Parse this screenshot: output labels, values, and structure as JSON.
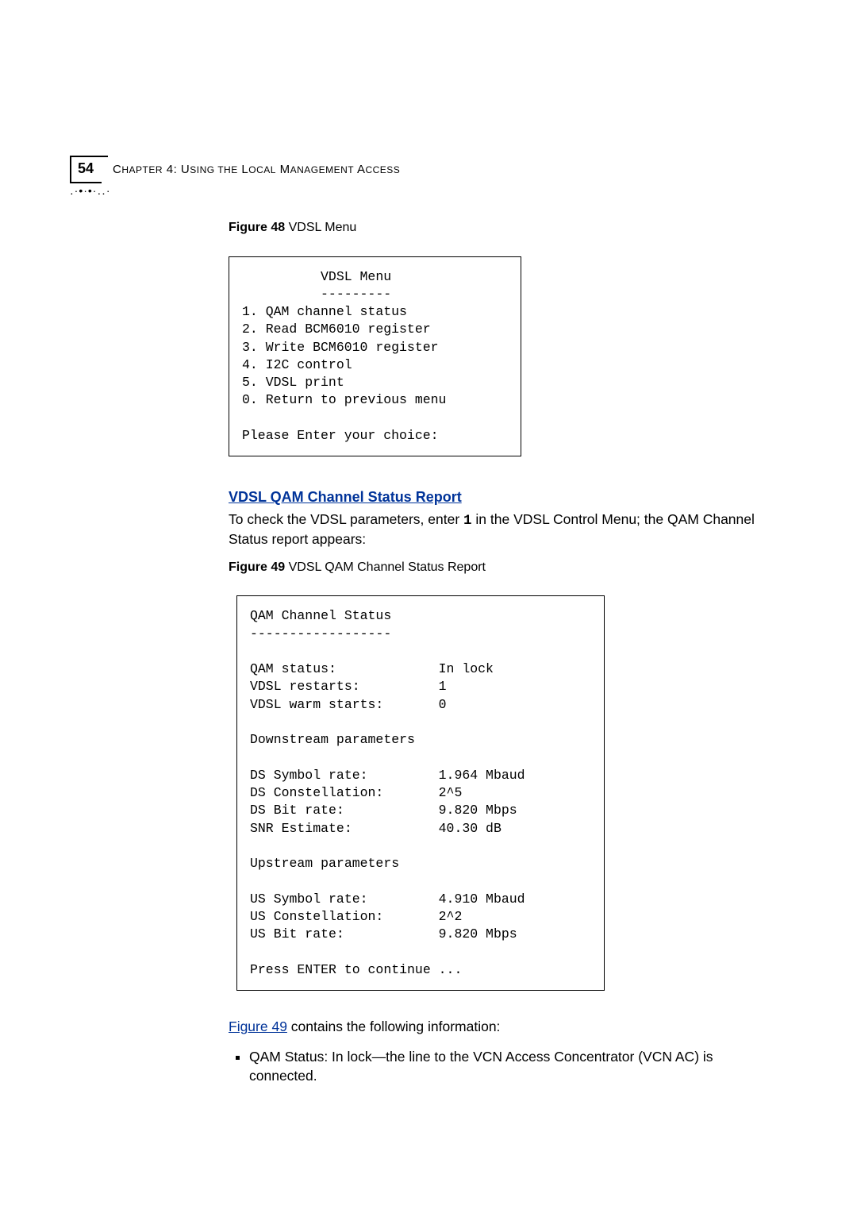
{
  "header": {
    "page_number": "54",
    "chapter_label": "Chapter 4: Using the Local Management Access"
  },
  "figure48": {
    "label_bold": "Figure 48",
    "label_rest": "   VDSL Menu",
    "title_center": "VDSL Menu",
    "title_dash": "---------",
    "items": [
      "1. QAM channel status",
      "2. Read BCM6010 register",
      "3. Write BCM6010 register",
      "4. I2C control",
      "5. VDSL print",
      "0. Return to previous menu"
    ],
    "prompt": "Please Enter your choice:"
  },
  "section": {
    "heading": "VDSL QAM Channel Status Report",
    "intro_before": "To check the VDSL parameters, enter ",
    "intro_key": "1",
    "intro_after": " in the VDSL Control Menu; the QAM Channel Status report appears:"
  },
  "figure49": {
    "label_bold": "Figure 49",
    "label_rest": "   VDSL QAM Channel Status Report",
    "title": "QAM Channel Status",
    "title_dash": "------------------",
    "rows_top": [
      {
        "k": "QAM status:",
        "v": "In lock"
      },
      {
        "k": "VDSL restarts:",
        "v": "1"
      },
      {
        "k": "VDSL warm starts:",
        "v": "0"
      }
    ],
    "ds_hdr": "Downstream parameters",
    "rows_ds": [
      {
        "k": "DS Symbol rate:",
        "v": "1.964 Mbaud"
      },
      {
        "k": "DS Constellation:",
        "v": "2^5"
      },
      {
        "k": "DS Bit rate:",
        "v": "9.820 Mbps"
      },
      {
        "k": "SNR Estimate:",
        "v": "40.30 dB"
      }
    ],
    "us_hdr": "Upstream parameters",
    "rows_us": [
      {
        "k": "US Symbol rate:",
        "v": "4.910 Mbaud"
      },
      {
        "k": "US Constellation:",
        "v": "2^2"
      },
      {
        "k": "US Bit rate:",
        "v": "9.820 Mbps"
      }
    ],
    "footer": "Press ENTER to continue ..."
  },
  "after": {
    "ref_link": "Figure 49",
    "ref_rest": " contains the following information:",
    "bullet": "QAM Status: In lock—the line to the VCN Access Concentrator (VCN AC) is connected."
  },
  "chart_data": {
    "type": "table",
    "title": "QAM Channel Status",
    "rows": [
      {
        "parameter": "QAM status",
        "value": "In lock"
      },
      {
        "parameter": "VDSL restarts",
        "value": 1
      },
      {
        "parameter": "VDSL warm starts",
        "value": 0
      },
      {
        "parameter": "DS Symbol rate",
        "value": 1.964,
        "unit": "Mbaud"
      },
      {
        "parameter": "DS Constellation",
        "value": "2^5"
      },
      {
        "parameter": "DS Bit rate",
        "value": 9.82,
        "unit": "Mbps"
      },
      {
        "parameter": "SNR Estimate",
        "value": 40.3,
        "unit": "dB"
      },
      {
        "parameter": "US Symbol rate",
        "value": 4.91,
        "unit": "Mbaud"
      },
      {
        "parameter": "US Constellation",
        "value": "2^2"
      },
      {
        "parameter": "US Bit rate",
        "value": 9.82,
        "unit": "Mbps"
      }
    ]
  }
}
